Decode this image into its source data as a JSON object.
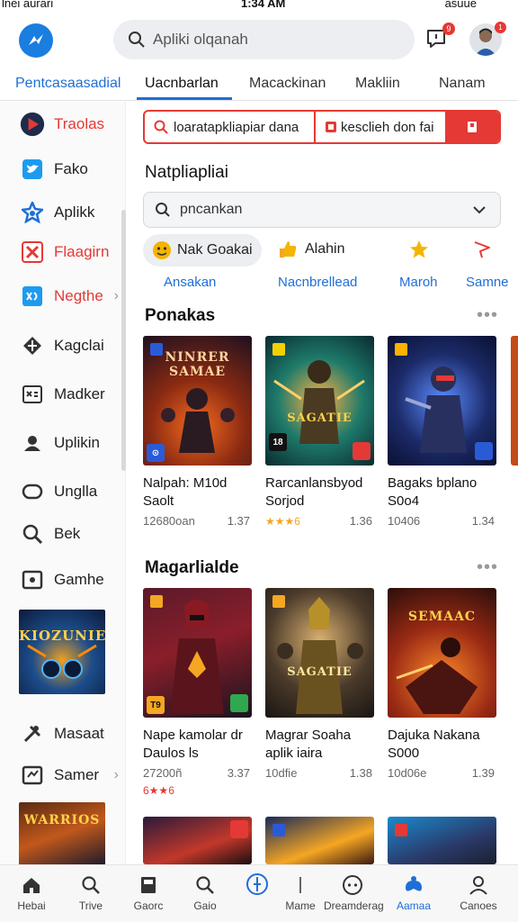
{
  "status_bar": {
    "carrier": "lnei aurari",
    "time": "1:34 AM",
    "battery_text": "asuue"
  },
  "header": {
    "search_placeholder": "Apliki olqanah",
    "notification_count": "9",
    "avatar_badge": "1"
  },
  "tabs": [
    {
      "label": "Pentcasaasadial",
      "state": "accent"
    },
    {
      "label": "Uacnbarlan",
      "state": "selected"
    },
    {
      "label": "Macackinan",
      "state": "normal"
    },
    {
      "label": "Makliin",
      "state": "normal"
    },
    {
      "label": "Nanam",
      "state": "normal"
    }
  ],
  "sidebar": {
    "items": [
      {
        "label": "Traolas",
        "icon": "play-triangle-icon",
        "color": "#e53935"
      },
      {
        "label": "Fako",
        "icon": "twitter-bird-icon",
        "color": "#222222"
      },
      {
        "label": "Aplikk",
        "icon": "star-badge-icon",
        "color": "#222222"
      },
      {
        "label": "Flaagirn",
        "icon": "cross-box-icon",
        "color": "#e53935"
      },
      {
        "label": "Negthe",
        "icon": "game-controller-icon",
        "color": "#e53935"
      },
      {
        "label": "Kagclai",
        "icon": "shield-icon",
        "color": "#222222"
      },
      {
        "label": "Madker",
        "icon": "image-box-icon",
        "color": "#222222"
      },
      {
        "label": "Uplikin",
        "icon": "person-icon",
        "color": "#222222"
      },
      {
        "label": "Unglla",
        "icon": "rounded-rect-icon",
        "color": "#222222"
      },
      {
        "label": "Bek",
        "icon": "magnifier-icon",
        "color": "#222222"
      },
      {
        "label": "Gamhe",
        "icon": "gallery-icon",
        "color": "#222222"
      },
      {
        "label": "Masaat",
        "icon": "tools-icon",
        "color": "#222222"
      },
      {
        "label": "Samer",
        "icon": "puzzle-icon",
        "color": "#222222"
      }
    ],
    "thumb1_text": "KIOZUNIE",
    "thumb2_text": "WARRIOS"
  },
  "filters": {
    "seg1": "loaratapkliapiar dana",
    "seg2": "kesclieh don fai"
  },
  "category": {
    "title": "Natpliapliai",
    "dropdown_value": "pncankan"
  },
  "chips": [
    {
      "label": "Nak Goakai",
      "sub": "Ansakan"
    },
    {
      "label": "Alahin",
      "sub": "Nacnbrellead"
    },
    {
      "label": "",
      "sub": "Maroh"
    },
    {
      "label": "",
      "sub": "Samne"
    }
  ],
  "sections": [
    {
      "title": "Ponakas",
      "more": "•••",
      "cards": [
        {
          "art_text": "NINRER SAMAE",
          "title_1": "Nalpah: M10d",
          "title_2": "Saolt",
          "meta": "12680oan",
          "size": "1.37",
          "stars": ""
        },
        {
          "art_text": "SAGATIE",
          "title_1": "Rarcanlansbyod",
          "title_2": "Sorjod",
          "meta": "",
          "size": "1.36",
          "stars": "★★★6"
        },
        {
          "art_text": "",
          "title_1": "Bagaks bplano",
          "title_2": "S0o4",
          "meta": "10406",
          "size": "1.34",
          "stars": ""
        }
      ]
    },
    {
      "title": "Magarlialde",
      "more": "•••",
      "cards": [
        {
          "art_text": "",
          "title_1": "Nape kamolar dr",
          "title_2": "Daulos ls",
          "meta": "27200ñ",
          "size": "3.37",
          "stars": "6★★6"
        },
        {
          "art_text": "SAGATIE",
          "title_1": "Magrar Soaha",
          "title_2": "aplik iaira",
          "meta": "10dfie",
          "size": "1.38",
          "stars": ""
        },
        {
          "art_text": "SEMAAC",
          "title_1": "Dajuka Nakana",
          "title_2": "S000",
          "meta": "10d06e",
          "size": "1.39",
          "stars": ""
        }
      ]
    }
  ],
  "bottom_nav": [
    {
      "label": "Hebai",
      "icon": "home-icon"
    },
    {
      "label": "Trive",
      "icon": "search-icon"
    },
    {
      "label": "Gaorc",
      "icon": "book-icon"
    },
    {
      "label": "Gaio",
      "icon": "search-icon"
    },
    {
      "label": "",
      "icon": "compass-icon"
    },
    {
      "label": "Mame",
      "icon": "divider-icon"
    },
    {
      "label": "Dreamderag",
      "icon": "chat-icon"
    },
    {
      "label": "Aamaa",
      "icon": "controller-icon"
    },
    {
      "label": "Canoes",
      "icon": "profile-icon"
    }
  ],
  "colors": {
    "accent_blue": "#1f6fd6",
    "accent_red": "#e53935",
    "star": "#f5a623"
  }
}
